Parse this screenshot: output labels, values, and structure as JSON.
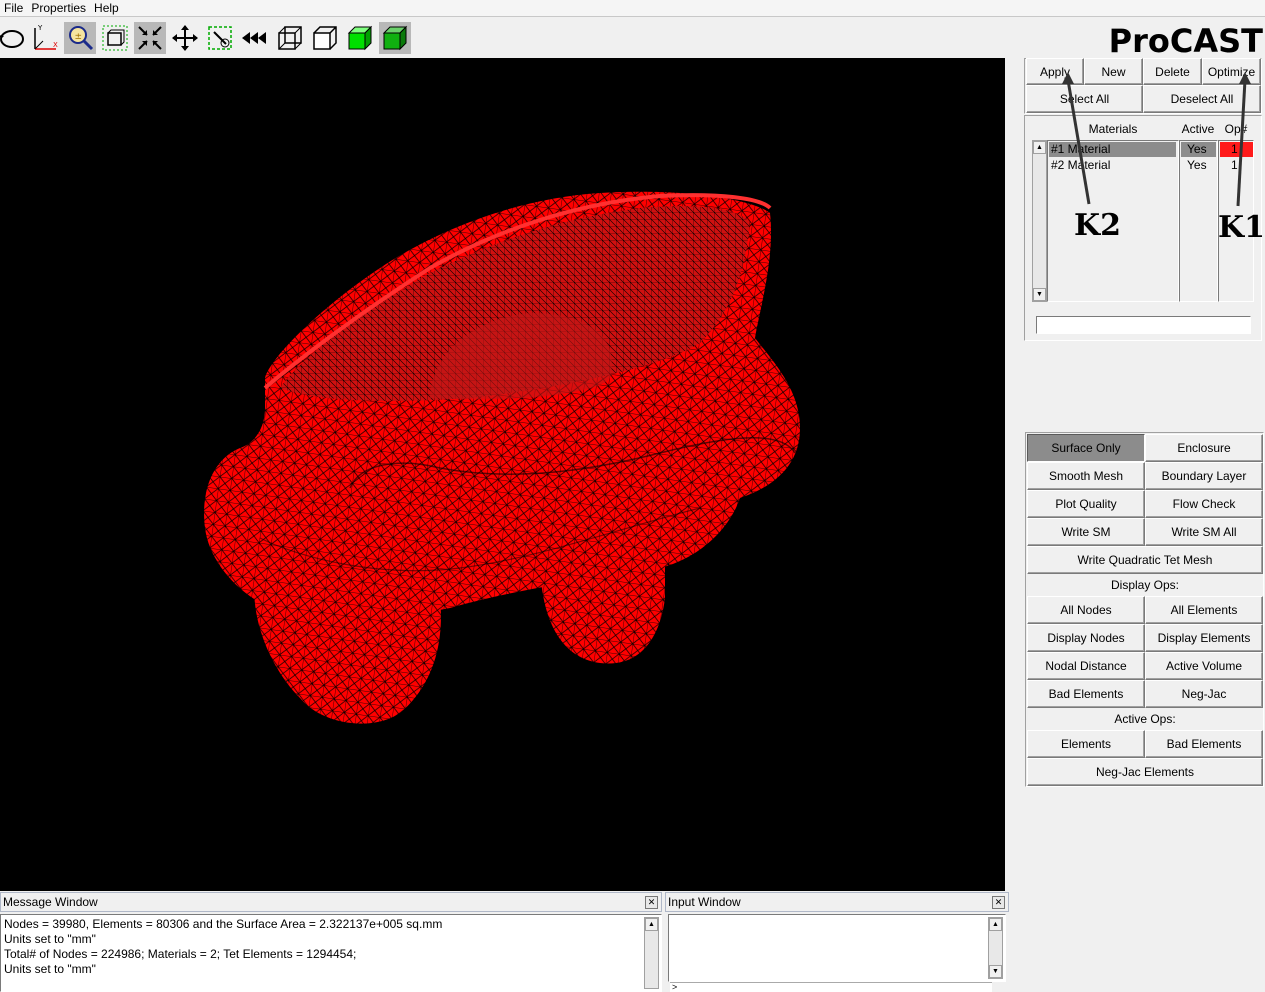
{
  "menu": {
    "file": "File",
    "properties": "Properties",
    "help": "Help"
  },
  "toolbar": {
    "buttons": [
      "rotate-icon",
      "axes-icon",
      "zoom-icon",
      "fit-view-icon",
      "shrink-icon",
      "pan-icon",
      "pick-icon",
      "rewind-icon",
      "wireframe-box-icon",
      "box-icon",
      "green-cube-icon",
      "solid-cube-icon"
    ]
  },
  "logo": "ProCAST",
  "top_buttons": {
    "apply": "Apply",
    "new": "New",
    "delete": "Delete",
    "optimize": "Optimize",
    "select_all": "Select All",
    "deselect_all": "Deselect All"
  },
  "materials": {
    "headers": {
      "materials": "Materials",
      "active": "Active",
      "op": "Op#"
    },
    "rows": [
      {
        "name": "#1 Material",
        "active": "Yes",
        "op": "1"
      },
      {
        "name": "#2 Material",
        "active": "Yes",
        "op": "1"
      }
    ]
  },
  "annotations": {
    "k2": "K2",
    "k1": "K1"
  },
  "ops": {
    "surface_only": "Surface Only",
    "enclosure": "Enclosure",
    "smooth_mesh": "Smooth Mesh",
    "boundary_layer": "Boundary Layer",
    "plot_quality": "Plot Quality",
    "flow_check": "Flow Check",
    "write_sm": "Write SM",
    "write_sm_all": "Write SM All",
    "write_quad": "Write Quadratic Tet Mesh",
    "display_ops": "Display Ops:",
    "all_nodes": "All Nodes",
    "all_elements": "All Elements",
    "display_nodes": "Display Nodes",
    "display_elements": "Display Elements",
    "nodal_distance": "Nodal Distance",
    "active_volume": "Active Volume",
    "bad_elements": "Bad Elements",
    "neg_jac": "Neg-Jac",
    "active_ops": "Active Ops:",
    "elements": "Elements",
    "bad_elements2": "Bad Elements",
    "neg_jac_elements": "Neg-Jac Elements"
  },
  "message_window": {
    "title": "Message Window",
    "lines": [
      "Nodes = 39980,  Elements = 80306 and the Surface Area = 2.322137e+005 sq.mm",
      "Units set to \"mm\"",
      "Total# of Nodes = 224986; Materials = 2; Tet Elements = 1294454;",
      "Units set to \"mm\""
    ]
  },
  "input_window": {
    "title": "Input Window",
    "prompt": ">"
  },
  "colors": {
    "mesh": "#ff0000",
    "selected_op": "#ff1a1a",
    "viewport_bg": "#000000"
  }
}
